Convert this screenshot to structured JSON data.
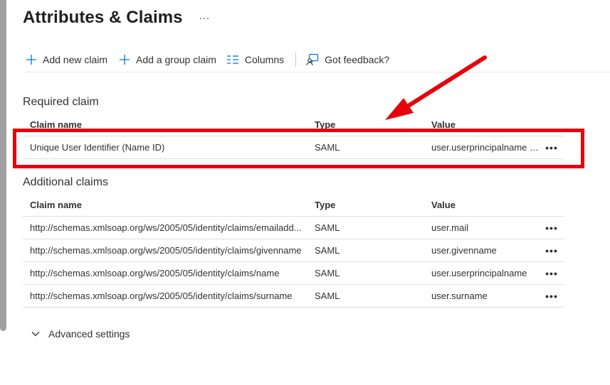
{
  "page": {
    "title": "Attributes & Claims",
    "more_icon": "…"
  },
  "toolbar": {
    "add_claim": "Add new claim",
    "add_group_claim": "Add a group claim",
    "columns": "Columns",
    "feedback": "Got feedback?"
  },
  "required": {
    "section_title": "Required claim",
    "headers": {
      "name": "Claim name",
      "type": "Type",
      "value": "Value"
    },
    "rows": [
      {
        "name": "Unique User Identifier (Name ID)",
        "type": "SAML",
        "value": "user.userprincipalname [..."
      }
    ]
  },
  "additional": {
    "section_title": "Additional claims",
    "headers": {
      "name": "Claim name",
      "type": "Type",
      "value": "Value"
    },
    "rows": [
      {
        "name": "http://schemas.xmlsoap.org/ws/2005/05/identity/claims/emailadd...",
        "type": "SAML",
        "value": "user.mail"
      },
      {
        "name": "http://schemas.xmlsoap.org/ws/2005/05/identity/claims/givenname",
        "type": "SAML",
        "value": "user.givenname"
      },
      {
        "name": "http://schemas.xmlsoap.org/ws/2005/05/identity/claims/name",
        "type": "SAML",
        "value": "user.userprincipalname"
      },
      {
        "name": "http://schemas.xmlsoap.org/ws/2005/05/identity/claims/surname",
        "type": "SAML",
        "value": "user.surname"
      }
    ]
  },
  "row_more": "•••",
  "advanced_settings": "Advanced settings",
  "colors": {
    "accent": "#0078d4",
    "annotation_red": "#e8000b"
  }
}
